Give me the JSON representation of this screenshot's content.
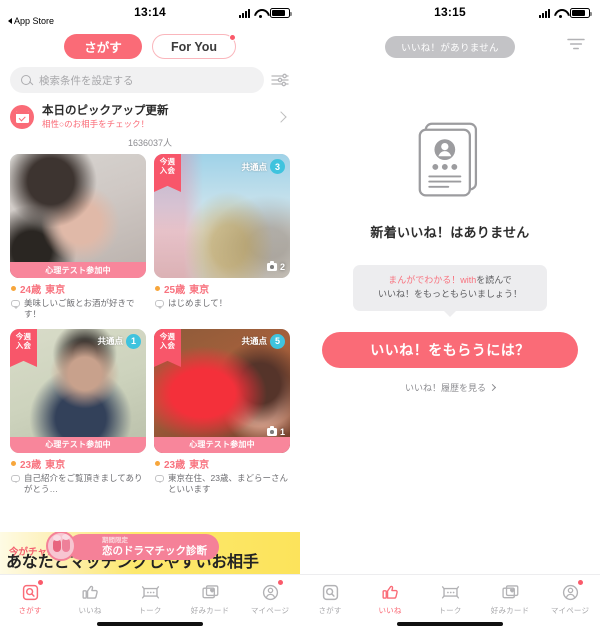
{
  "left": {
    "status": {
      "time": "13:14",
      "back_label": "App Store"
    },
    "tabs": [
      {
        "label": "さがす",
        "active": true,
        "badge": false
      },
      {
        "label": "For You",
        "active": false,
        "badge": true
      }
    ],
    "search": {
      "placeholder": "検索条件を設定する",
      "filter_icon": "sliders-icon"
    },
    "pickup": {
      "icon": "calendar-check-icon",
      "title": "本日のピックアップ更新",
      "subtitle": "相性○のお相手をチェック！",
      "chevron": "chevron-right-icon"
    },
    "count_text": "1636037人",
    "cards": [
      {
        "ribbon": "",
        "ribbon_lines": [
          "",
          ""
        ],
        "common_label": "",
        "common_count": "",
        "photo_count": "",
        "test_band": "心理テスト参加中",
        "age": "24歳",
        "location": "東京",
        "bio": "美味しいご飯とお酒が好きです！",
        "online": true
      },
      {
        "ribbon": "今週入会",
        "ribbon_lines": [
          "今週",
          "入会"
        ],
        "common_label": "共通点",
        "common_count": "3",
        "photo_count": "2",
        "test_band": "",
        "age": "25歳",
        "location": "東京",
        "bio": "はじめまして！",
        "online": true
      },
      {
        "ribbon": "今週入会",
        "ribbon_lines": [
          "今週",
          "入会"
        ],
        "common_label": "共通点",
        "common_count": "1",
        "photo_count": "",
        "test_band": "心理テスト参加中",
        "age": "23歳",
        "location": "東京",
        "bio": "自己紹介をご覧頂きましてありがとう…",
        "online": true
      },
      {
        "ribbon": "今週入会",
        "ribbon_lines": [
          "今週",
          "入会"
        ],
        "common_label": "共通点",
        "common_count": "5",
        "photo_count": "1",
        "test_band": "心理テスト参加中",
        "age": "23歳",
        "location": "東京",
        "bio": "東京在住、23歳、まどらーさんといいます",
        "online": true
      }
    ],
    "promo": {
      "chance": "今がチャンス！",
      "headline": "あなたとマッチングしやすいお相手",
      "pill_small": "期間限定",
      "pill_large": "恋のドラマチック診断",
      "badge_icon": "couple-avatar-icon"
    },
    "tabbar": [
      {
        "label": "さがす",
        "icon": "search-card-icon",
        "active": true,
        "badge": true
      },
      {
        "label": "いいね",
        "icon": "thumbs-up-icon",
        "active": false,
        "badge": false
      },
      {
        "label": "トーク",
        "icon": "chat-icon",
        "active": false,
        "badge": false
      },
      {
        "label": "好みカード",
        "icon": "preference-card-icon",
        "active": false,
        "badge": false
      },
      {
        "label": "マイページ",
        "icon": "person-circle-icon",
        "active": false,
        "badge": true
      }
    ]
  },
  "right": {
    "status": {
      "time": "13:15"
    },
    "chip": "いいね！がありません",
    "filter_icon": "filter-icon",
    "empty": {
      "illustration": "profile-cards-icon",
      "title": "新着いいね！はありません"
    },
    "tip": {
      "line1_highlight": "まんがでわかる！with",
      "line1_rest": "を読んで",
      "line2": "いいね！をもっともらいましょう！"
    },
    "cta": "いいね！をもらうには？",
    "history": "いいね！履歴を見る",
    "tabbar": [
      {
        "label": "さがす",
        "icon": "search-card-icon",
        "active": false,
        "badge": false
      },
      {
        "label": "いいね",
        "icon": "thumbs-up-icon",
        "active": true,
        "badge": false
      },
      {
        "label": "トーク",
        "icon": "chat-icon",
        "active": false,
        "badge": false
      },
      {
        "label": "好みカード",
        "icon": "preference-card-icon",
        "active": false,
        "badge": false
      },
      {
        "label": "マイページ",
        "icon": "person-circle-icon",
        "active": false,
        "badge": true
      }
    ]
  },
  "colors": {
    "brand": "#FA6B77",
    "brand_deep": "#F8566A",
    "band_pink": "#F8869B",
    "cyan": "#3FC3DE",
    "online_orange": "#F7A63B",
    "promo_yellow": "#FCE35B",
    "grey_chip": "#C3C3C6"
  }
}
